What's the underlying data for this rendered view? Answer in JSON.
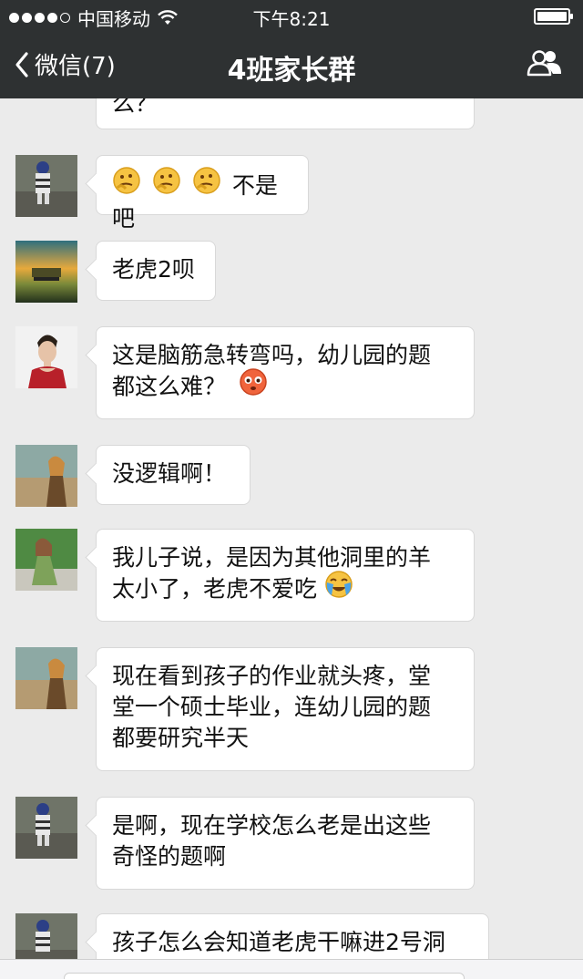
{
  "status_bar": {
    "carrier": "中国移动",
    "time": "下午8:21"
  },
  "nav": {
    "back_label": "微信(7)",
    "title": "4班家长群"
  },
  "messages": [
    {
      "text": "么？"
    },
    {
      "emoji_count": 3,
      "text": "不是吧"
    },
    {
      "text": "老虎2呗"
    },
    {
      "line1": "这是脑筋急转弯吗，幼儿园的题",
      "line2": "都这么难？"
    },
    {
      "text": "没逻辑啊！"
    },
    {
      "line1": "我儿子说，是因为其他洞里的羊",
      "line2": "太小了，老虎不爱吃"
    },
    {
      "line1": "现在看到孩子的作业就头疼，堂",
      "line2": "堂一个硕士毕业，连幼儿园的题",
      "line3": "都要研究半天"
    },
    {
      "line1": "是啊，现在学校怎么老是出这些",
      "line2": "奇怪的题啊"
    },
    {
      "text": "孩子怎么会知道老虎干嘛进2号洞"
    }
  ]
}
